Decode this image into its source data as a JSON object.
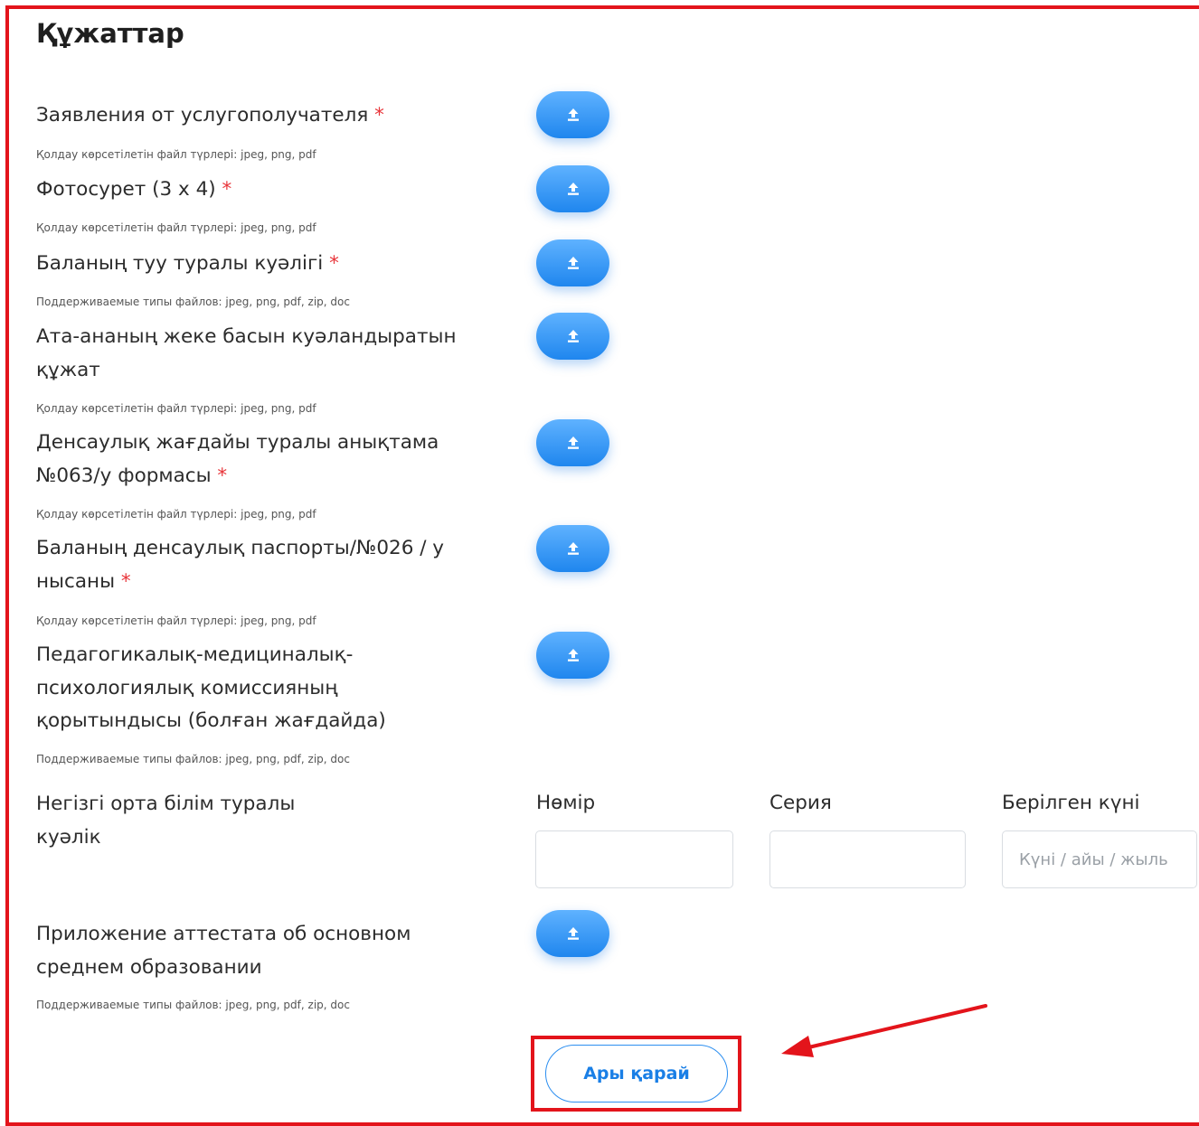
{
  "page": {
    "title": "Құжаттар"
  },
  "documents": [
    {
      "label": "Заявления от услугополучателя",
      "required": "*",
      "hint": "Қолдау көрсетілетін файл түрлері: jpeg, png, pdf"
    },
    {
      "label": "Фотосурет (3 x 4)",
      "required": "*",
      "hint": "Қолдау көрсетілетін файл түрлері: jpeg, png, pdf"
    },
    {
      "label": "Баланың туу туралы куәлігі",
      "required": "*",
      "hint": "Поддерживаемые типы файлов: jpeg, png, pdf, zip, doc"
    },
    {
      "label": "Ата-ананың жеке басын куәландыратын құжат",
      "required": "",
      "hint": "Қолдау көрсетілетін файл түрлері: jpeg, png, pdf"
    },
    {
      "label": "Денсаулық жағдайы туралы анықтама №063/у формасы",
      "required": "*",
      "hint": "Қолдау көрсетілетін файл түрлері: jpeg, png, pdf"
    },
    {
      "label": "Баланың денсаулық паспорты/№026 / у нысаны",
      "required": "*",
      "hint": "Қолдау көрсетілетін файл түрлері: jpeg, png, pdf"
    },
    {
      "label": "Педагогикалық-медициналық-психологиялық комиссияның қорытындысы (болған жағдайда)",
      "required": "",
      "hint": "Поддерживаемые типы файлов: jpeg, png, pdf, zip, doc"
    }
  ],
  "certificate": {
    "label": "Негізгі орта білім туралы куәлік",
    "number_label": "Нөмір",
    "number_value": "",
    "series_label": "Серия",
    "series_value": "",
    "date_label": "Берілген күні",
    "date_placeholder": "Күні / айы / жыль"
  },
  "attachment": {
    "label": "Приложение аттестата об основном среднем образовании",
    "hint": "Поддерживаемые типы файлов: jpeg, png, pdf, zip, doc"
  },
  "next_button": {
    "label": "Ары қарай"
  },
  "icons": {
    "upload": "upload-icon"
  },
  "colors": {
    "accent": "#1f86ee",
    "required": "#e8353a",
    "highlight": "#e3141b"
  }
}
